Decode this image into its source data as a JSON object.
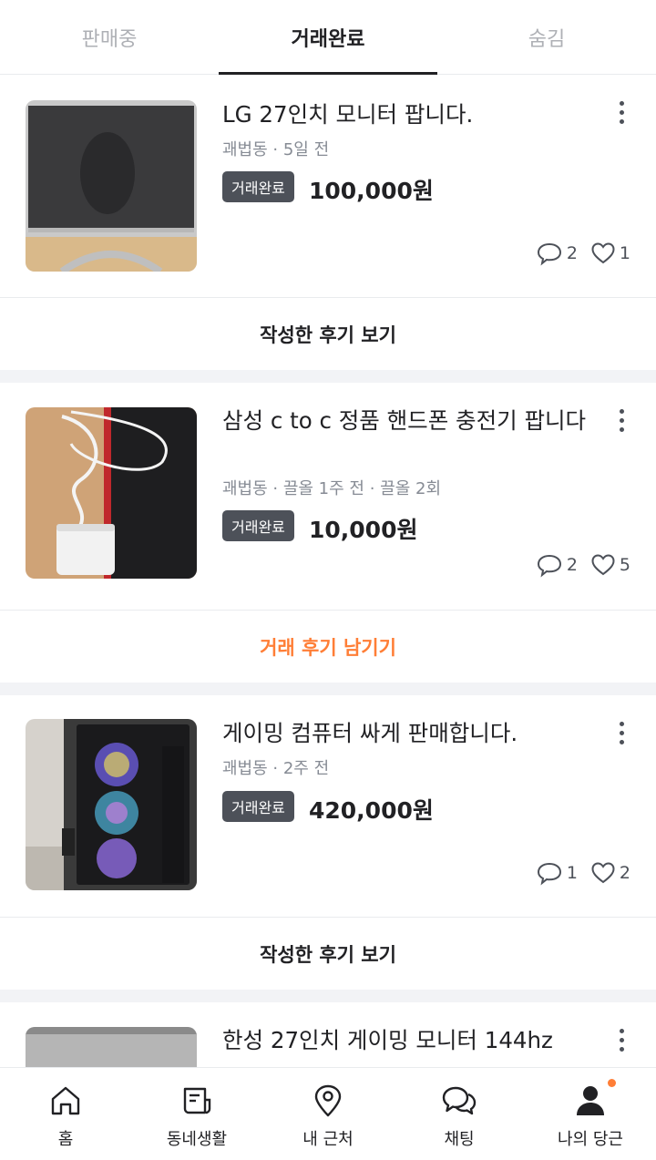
{
  "tabs": [
    {
      "label": "판매중",
      "active": false
    },
    {
      "label": "거래완료",
      "active": true
    },
    {
      "label": "숨김",
      "active": false
    }
  ],
  "items": [
    {
      "title": "LG 27인치 모니터 팝니다.",
      "meta": "괘법동 · 5일 전",
      "badge": "거래완료",
      "price": "100,000원",
      "comments": "2",
      "likes": "1",
      "review_label": "작성한 후기 보기"
    },
    {
      "title": "삼성 c to c 정품 핸드폰 충전기 팝니다",
      "meta": "괘법동 · 끌올 1주 전 · 끌올 2회",
      "badge": "거래완료",
      "price": "10,000원",
      "comments": "2",
      "likes": "5",
      "review_label": "거래 후기 남기기"
    },
    {
      "title": "게이밍 컴퓨터 싸게 판매합니다.",
      "meta": "괘법동 · 2주 전",
      "badge": "거래완료",
      "price": "420,000원",
      "comments": "1",
      "likes": "2",
      "review_label": "작성한 후기 보기"
    },
    {
      "title": "한성 27인치 게이밍 모니터 144hz"
    }
  ],
  "bottom_nav": [
    {
      "label": "홈",
      "icon": "home-icon"
    },
    {
      "label": "동네생활",
      "icon": "board-icon"
    },
    {
      "label": "내 근처",
      "icon": "location-pin-icon"
    },
    {
      "label": "채팅",
      "icon": "chat-icon"
    },
    {
      "label": "나의 당근",
      "icon": "person-icon"
    }
  ],
  "colors": {
    "accent": "#ff7e36",
    "badge_bg": "#4d5159",
    "text": "#212124",
    "muted": "#868b94"
  }
}
